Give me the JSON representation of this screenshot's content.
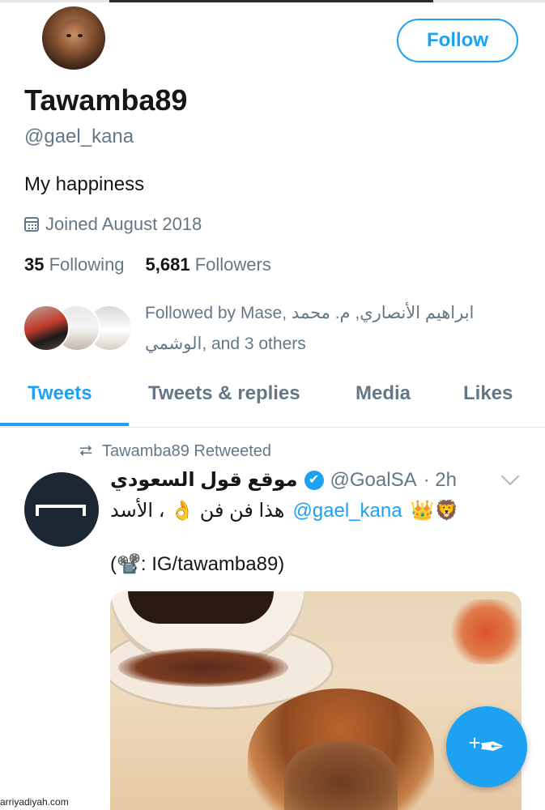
{
  "profile": {
    "display_name": "Tawamba89",
    "handle": "@gael_kana",
    "bio": "My happiness",
    "joined": "Joined August 2018",
    "following_count": "35",
    "following_label": "Following",
    "followers_count": "5,681",
    "followers_label": "Followers",
    "follow_button": "Follow",
    "followed_by_text": "Followed by Mase, ابراهيم الأنصاري, م. محمد الوشمي, and 3 others"
  },
  "tabs": [
    {
      "label": "Tweets",
      "active": true
    },
    {
      "label": "Tweets & replies",
      "active": false
    },
    {
      "label": "Media",
      "active": false
    },
    {
      "label": "Likes",
      "active": false
    }
  ],
  "tweet": {
    "retweet_label": "Tawamba89 Retweeted",
    "author_name": "موقع قول السعودي",
    "author_handle": "@GoalSA",
    "time": "· 2h",
    "verified": "✔",
    "text_arabic": "هذا فن فن 👌 ، الأسد",
    "mention": "@gael_kana",
    "emojis": "👑🦁",
    "text_line2": "(📽️: IG/tawamba89)"
  },
  "compose": {
    "icon": "compose-tweet-icon",
    "plus": "+",
    "quill": "✒"
  },
  "watermark": "arriyadiyah.com",
  "colors": {
    "accent": "#1da1f2",
    "secondary_text": "#657786",
    "primary_text": "#14171a"
  }
}
